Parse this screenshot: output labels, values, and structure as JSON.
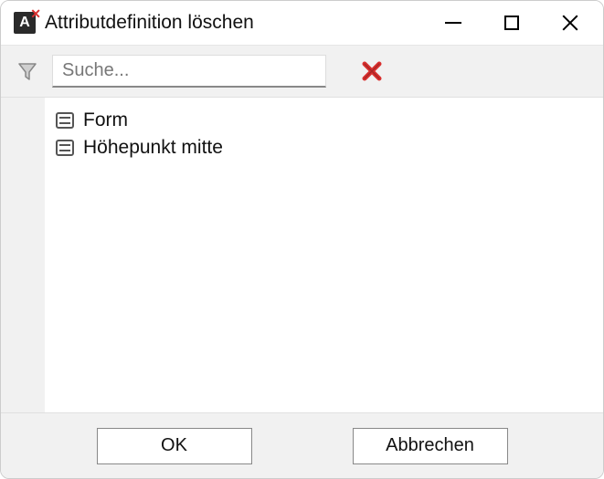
{
  "window": {
    "title": "Attributdefinition löschen"
  },
  "toolbar": {
    "search_placeholder": "Suche..."
  },
  "list": {
    "items": [
      {
        "label": "Form"
      },
      {
        "label": "Höhepunkt mitte"
      }
    ]
  },
  "footer": {
    "ok_label": "OK",
    "cancel_label": "Abbrechen"
  }
}
